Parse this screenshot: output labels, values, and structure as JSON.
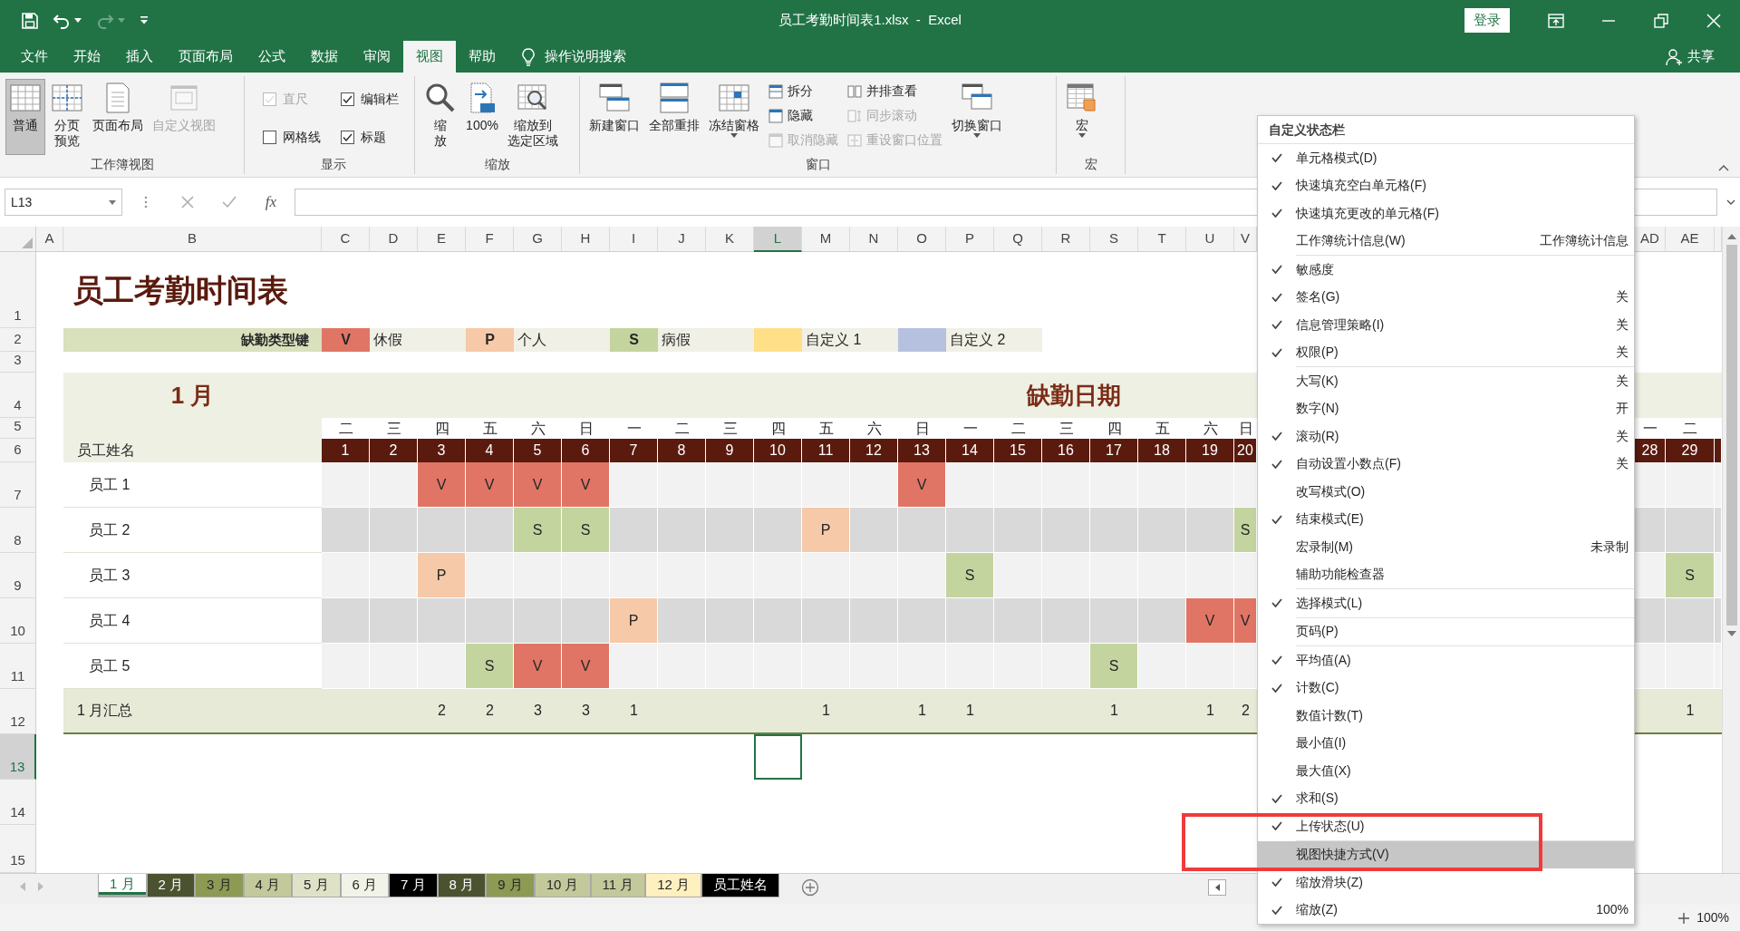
{
  "window": {
    "title": "员工考勤时间表1.xlsx  -  Excel",
    "sign_in": "登录"
  },
  "ribbon_tabs": [
    {
      "label": "文件",
      "selected": false
    },
    {
      "label": "开始",
      "selected": false
    },
    {
      "label": "插入",
      "selected": false
    },
    {
      "label": "页面布局",
      "selected": false
    },
    {
      "label": "公式",
      "selected": false
    },
    {
      "label": "数据",
      "selected": false
    },
    {
      "label": "审阅",
      "selected": false
    },
    {
      "label": "视图",
      "selected": true
    },
    {
      "label": "帮助",
      "selected": false
    }
  ],
  "tell_me": "操作说明搜索",
  "share": "共享",
  "ribbon_groups": [
    {
      "title": "工作簿视图",
      "columns": [
        [
          {
            "kind": "large",
            "lines": [
              "普通"
            ],
            "selected": true,
            "disabled": false
          }
        ],
        [
          {
            "kind": "large",
            "lines": [
              "分页",
              "预览"
            ],
            "selected": false,
            "disabled": false
          }
        ],
        [
          {
            "kind": "large",
            "lines": [
              "页面布局"
            ],
            "selected": false,
            "disabled": false
          }
        ],
        [
          {
            "kind": "large",
            "lines": [
              "自定义视图"
            ],
            "selected": false,
            "disabled": true
          }
        ]
      ]
    },
    {
      "title": "显示",
      "columns": [
        [
          {
            "kind": "check",
            "label": "直尺",
            "checked": true,
            "disabled": true
          },
          {
            "kind": "check",
            "label": "网格线",
            "checked": false,
            "disabled": false
          }
        ],
        [
          {
            "kind": "check",
            "label": "编辑栏",
            "checked": true,
            "disabled": false
          },
          {
            "kind": "check",
            "label": "标题",
            "checked": true,
            "disabled": false
          }
        ]
      ]
    },
    {
      "title": "缩放",
      "columns": [
        [
          {
            "kind": "large",
            "lines": [
              "缩",
              "放"
            ],
            "disabled": false
          }
        ],
        [
          {
            "kind": "large",
            "lines": [
              "100%"
            ],
            "disabled": false
          }
        ],
        [
          {
            "kind": "large",
            "lines": [
              "缩放到",
              "选定区域"
            ],
            "disabled": false
          }
        ]
      ]
    },
    {
      "title": "窗口",
      "columns": [
        [
          {
            "kind": "large",
            "lines": [
              "新建窗口"
            ],
            "disabled": false
          }
        ],
        [
          {
            "kind": "large",
            "lines": [
              "全部重排"
            ],
            "disabled": false
          }
        ],
        [
          {
            "kind": "large",
            "lines": [
              "冻结窗格"
            ],
            "disabled": false,
            "dropdown": true
          }
        ],
        [
          {
            "kind": "small",
            "label": "拆分",
            "disabled": false
          },
          {
            "kind": "small",
            "label": "隐藏",
            "disabled": false
          },
          {
            "kind": "small",
            "label": "取消隐藏",
            "disabled": true
          }
        ],
        [
          {
            "kind": "small",
            "label": "并排查看",
            "disabled": false
          },
          {
            "kind": "small",
            "label": "同步滚动",
            "disabled": true
          },
          {
            "kind": "small",
            "label": "重设窗口位置",
            "disabled": true
          }
        ],
        [
          {
            "kind": "large",
            "lines": [
              "切换窗口"
            ],
            "disabled": false,
            "dropdown": true
          }
        ]
      ]
    },
    {
      "title": "宏",
      "columns": [
        [
          {
            "kind": "large",
            "lines": [
              "宏"
            ],
            "disabled": false,
            "dropdown": true
          }
        ]
      ]
    }
  ],
  "formula_bar": {
    "name_box": "L13",
    "function_button": "fx"
  },
  "sheet": {
    "column_headers": [
      {
        "label": "A",
        "selected": false
      },
      {
        "label": "B",
        "selected": false
      },
      {
        "label": "C",
        "selected": false
      },
      {
        "label": "D",
        "selected": false
      },
      {
        "label": "E",
        "selected": false
      },
      {
        "label": "F",
        "selected": false
      },
      {
        "label": "G",
        "selected": false
      },
      {
        "label": "H",
        "selected": false
      },
      {
        "label": "I",
        "selected": false
      },
      {
        "label": "J",
        "selected": false
      },
      {
        "label": "K",
        "selected": false
      },
      {
        "label": "L",
        "selected": true
      },
      {
        "label": "M",
        "selected": false
      },
      {
        "label": "N",
        "selected": false
      },
      {
        "label": "O",
        "selected": false
      },
      {
        "label": "P",
        "selected": false
      },
      {
        "label": "Q",
        "selected": false
      },
      {
        "label": "R",
        "selected": false
      },
      {
        "label": "S",
        "selected": false
      },
      {
        "label": "T",
        "selected": false
      },
      {
        "label": "U",
        "selected": false
      },
      {
        "label": "V",
        "selected": false
      },
      {
        "label": "AD",
        "selected": false
      },
      {
        "label": "AE",
        "selected": false
      }
    ],
    "row_headers": [
      {
        "label": "1",
        "selected": false
      },
      {
        "label": "2",
        "selected": false
      },
      {
        "label": "3",
        "selected": false
      },
      {
        "label": "4",
        "selected": false
      },
      {
        "label": "5",
        "selected": false
      },
      {
        "label": "6",
        "selected": false
      },
      {
        "label": "7",
        "selected": false
      },
      {
        "label": "8",
        "selected": false
      },
      {
        "label": "9",
        "selected": false
      },
      {
        "label": "10",
        "selected": false
      },
      {
        "label": "11",
        "selected": false
      },
      {
        "label": "12",
        "selected": false
      },
      {
        "label": "13",
        "selected": true
      },
      {
        "label": "14",
        "selected": false
      },
      {
        "label": "15",
        "selected": false
      }
    ],
    "title": "员工考勤时间表",
    "legend": {
      "label": "缺勤类型键",
      "items": [
        {
          "code": "V",
          "text": "休假",
          "color": "#e07565"
        },
        {
          "code": "P",
          "text": "个人",
          "color": "#f6c9a8"
        },
        {
          "code": "S",
          "text": "病假",
          "color": "#c4d49f"
        },
        {
          "text": "自定义 1",
          "color": "#ffdf88"
        },
        {
          "text": "自定义 2",
          "color": "#b6c1df"
        }
      ]
    },
    "month": "1 月",
    "section_title": "缺勤日期",
    "weekdays": [
      "二",
      "三",
      "四",
      "五",
      "六",
      "日",
      "一",
      "二",
      "三",
      "四",
      "五",
      "六",
      "日",
      "一",
      "二",
      "三",
      "四",
      "五",
      "六",
      "日",
      "一",
      "二"
    ],
    "days": [
      "1",
      "2",
      "3",
      "4",
      "5",
      "6",
      "7",
      "8",
      "9",
      "10",
      "11",
      "12",
      "13",
      "14",
      "15",
      "16",
      "17",
      "18",
      "19",
      "20",
      "28",
      "29"
    ],
    "name_header": "员工姓名",
    "employees": [
      {
        "name": "员工 1",
        "cells": [
          {
            "kind": "empty"
          },
          {
            "kind": "empty"
          },
          {
            "kind": "absence",
            "code": "V",
            "color": "#e07565"
          },
          {
            "kind": "absence",
            "code": "V",
            "color": "#e07565"
          },
          {
            "kind": "absence",
            "code": "V",
            "color": "#e07565"
          },
          {
            "kind": "absence",
            "code": "V",
            "color": "#e07565"
          },
          {
            "kind": "empty"
          },
          {
            "kind": "empty"
          },
          {
            "kind": "empty"
          },
          {
            "kind": "empty"
          },
          {
            "kind": "empty"
          },
          {
            "kind": "empty"
          },
          {
            "kind": "absence",
            "code": "V",
            "color": "#e07565"
          },
          {
            "kind": "empty"
          },
          {
            "kind": "empty"
          },
          {
            "kind": "empty"
          },
          {
            "kind": "empty"
          },
          {
            "kind": "empty"
          },
          {
            "kind": "empty"
          },
          {
            "kind": "empty"
          },
          {
            "kind": "empty"
          },
          {
            "kind": "empty"
          }
        ]
      },
      {
        "name": "员工 2",
        "cells": [
          {
            "kind": "empty"
          },
          {
            "kind": "empty"
          },
          {
            "kind": "empty"
          },
          {
            "kind": "empty"
          },
          {
            "kind": "absence",
            "code": "S",
            "color": "#c4d49f"
          },
          {
            "kind": "absence",
            "code": "S",
            "color": "#c4d49f"
          },
          {
            "kind": "empty"
          },
          {
            "kind": "empty"
          },
          {
            "kind": "empty"
          },
          {
            "kind": "empty"
          },
          {
            "kind": "absence",
            "code": "P",
            "color": "#f6c9a8"
          },
          {
            "kind": "empty"
          },
          {
            "kind": "empty"
          },
          {
            "kind": "empty"
          },
          {
            "kind": "empty"
          },
          {
            "kind": "empty"
          },
          {
            "kind": "empty"
          },
          {
            "kind": "empty"
          },
          {
            "kind": "empty"
          },
          {
            "kind": "absence",
            "code": "S",
            "color": "#c4d49f"
          },
          {
            "kind": "empty"
          },
          {
            "kind": "empty"
          }
        ]
      },
      {
        "name": "员工 3",
        "cells": [
          {
            "kind": "empty"
          },
          {
            "kind": "empty"
          },
          {
            "kind": "absence",
            "code": "P",
            "color": "#f6c9a8"
          },
          {
            "kind": "empty"
          },
          {
            "kind": "empty"
          },
          {
            "kind": "empty"
          },
          {
            "kind": "empty"
          },
          {
            "kind": "empty"
          },
          {
            "kind": "empty"
          },
          {
            "kind": "empty"
          },
          {
            "kind": "empty"
          },
          {
            "kind": "empty"
          },
          {
            "kind": "empty"
          },
          {
            "kind": "absence",
            "code": "S",
            "color": "#c4d49f"
          },
          {
            "kind": "empty"
          },
          {
            "kind": "empty"
          },
          {
            "kind": "empty"
          },
          {
            "kind": "empty"
          },
          {
            "kind": "empty"
          },
          {
            "kind": "empty"
          },
          {
            "kind": "empty"
          },
          {
            "kind": "absence",
            "code": "S",
            "color": "#c4d49f"
          }
        ]
      },
      {
        "name": "员工 4",
        "cells": [
          {
            "kind": "empty"
          },
          {
            "kind": "empty"
          },
          {
            "kind": "empty"
          },
          {
            "kind": "empty"
          },
          {
            "kind": "empty"
          },
          {
            "kind": "empty"
          },
          {
            "kind": "absence",
            "code": "P",
            "color": "#f6c9a8"
          },
          {
            "kind": "empty"
          },
          {
            "kind": "empty"
          },
          {
            "kind": "empty"
          },
          {
            "kind": "empty"
          },
          {
            "kind": "empty"
          },
          {
            "kind": "empty"
          },
          {
            "kind": "empty"
          },
          {
            "kind": "empty"
          },
          {
            "kind": "empty"
          },
          {
            "kind": "empty"
          },
          {
            "kind": "empty"
          },
          {
            "kind": "absence",
            "code": "V",
            "color": "#e07565"
          },
          {
            "kind": "absence",
            "code": "V",
            "color": "#e07565"
          },
          {
            "kind": "empty"
          },
          {
            "kind": "empty"
          }
        ]
      },
      {
        "name": "员工 5",
        "cells": [
          {
            "kind": "empty"
          },
          {
            "kind": "empty"
          },
          {
            "kind": "empty"
          },
          {
            "kind": "absence",
            "code": "S",
            "color": "#c4d49f"
          },
          {
            "kind": "absence",
            "code": "V",
            "color": "#e07565"
          },
          {
            "kind": "absence",
            "code": "V",
            "color": "#e07565"
          },
          {
            "kind": "empty"
          },
          {
            "kind": "empty"
          },
          {
            "kind": "empty"
          },
          {
            "kind": "empty"
          },
          {
            "kind": "empty"
          },
          {
            "kind": "empty"
          },
          {
            "kind": "empty"
          },
          {
            "kind": "empty"
          },
          {
            "kind": "empty"
          },
          {
            "kind": "empty"
          },
          {
            "kind": "absence",
            "code": "S",
            "color": "#c4d49f"
          },
          {
            "kind": "empty"
          },
          {
            "kind": "empty"
          },
          {
            "kind": "empty"
          },
          {
            "kind": "empty"
          },
          {
            "kind": "empty"
          }
        ]
      }
    ],
    "total_label": "1 月汇总",
    "totals": [
      {
        "kind": "empty"
      },
      {
        "kind": "empty"
      },
      {
        "kind": "count",
        "value": "2"
      },
      {
        "kind": "count",
        "value": "2"
      },
      {
        "kind": "count",
        "value": "3"
      },
      {
        "kind": "count",
        "value": "3"
      },
      {
        "kind": "count",
        "value": "1"
      },
      {
        "kind": "empty"
      },
      {
        "kind": "empty"
      },
      {
        "kind": "empty"
      },
      {
        "kind": "count",
        "value": "1"
      },
      {
        "kind": "empty"
      },
      {
        "kind": "count",
        "value": "1"
      },
      {
        "kind": "count",
        "value": "1"
      },
      {
        "kind": "empty"
      },
      {
        "kind": "empty"
      },
      {
        "kind": "count",
        "value": "1"
      },
      {
        "kind": "empty"
      },
      {
        "kind": "count",
        "value": "1"
      },
      {
        "kind": "count",
        "value": "2"
      },
      {
        "kind": "empty"
      },
      {
        "kind": "count",
        "value": "1"
      }
    ]
  },
  "sheet_tabs": [
    {
      "label": "1 月",
      "selected": true,
      "color": "#217346"
    },
    {
      "label": "2 月",
      "selected": false,
      "color": "#4b5230"
    },
    {
      "label": "3 月",
      "selected": false,
      "color": "#8c9a54"
    },
    {
      "label": "4 月",
      "selected": false,
      "color": "#c3c99a"
    },
    {
      "label": "5 月",
      "selected": false,
      "color": "#dfe2c6"
    },
    {
      "label": "6 月",
      "selected": false,
      "color": "#f2f3e8"
    },
    {
      "label": "7 月",
      "selected": false,
      "color": "#000000"
    },
    {
      "label": "8 月",
      "selected": false,
      "color": "#4b5230"
    },
    {
      "label": "9 月",
      "selected": false,
      "color": "#8c9a54"
    },
    {
      "label": "10 月",
      "selected": false,
      "color": "#c3c99a"
    },
    {
      "label": "11 月",
      "selected": false,
      "color": "#c3c99a"
    },
    {
      "label": "12 月",
      "selected": false,
      "color": "#fff0c0"
    },
    {
      "label": "员工姓名",
      "selected": false,
      "color": "#000000"
    }
  ],
  "status_bar": {
    "zoom": "100%"
  },
  "context_menu": {
    "title": "自定义状态栏",
    "items": [
      {
        "label": "单元格模式(D)",
        "checked": true,
        "selected": false
      },
      {
        "label": "快速填充空白单元格(F)",
        "checked": true,
        "selected": false
      },
      {
        "label": "快速填充更改的单元格(F)",
        "checked": true,
        "selected": false
      },
      {
        "label": "工作簿统计信息(W)",
        "checked": false,
        "selected": false,
        "value": "工作簿统计信息",
        "separator_after": true
      },
      {
        "label": "敏感度",
        "checked": true,
        "selected": false
      },
      {
        "label": "签名(G)",
        "checked": true,
        "selected": false,
        "value": "关"
      },
      {
        "label": "信息管理策略(I)",
        "checked": true,
        "selected": false,
        "value": "关"
      },
      {
        "label": "权限(P)",
        "checked": true,
        "selected": false,
        "value": "关",
        "separator_after": true
      },
      {
        "label": "大写(K)",
        "checked": false,
        "selected": false,
        "value": "关"
      },
      {
        "label": "数字(N)",
        "checked": false,
        "selected": false,
        "value": "开"
      },
      {
        "label": "滚动(R)",
        "checked": true,
        "selected": false,
        "value": "关"
      },
      {
        "label": "自动设置小数点(F)",
        "checked": true,
        "selected": false,
        "value": "关"
      },
      {
        "label": "改写模式(O)",
        "checked": false,
        "selected": false
      },
      {
        "label": "结束模式(E)",
        "checked": true,
        "selected": false
      },
      {
        "label": "宏录制(M)",
        "checked": false,
        "selected": false,
        "value": "未录制"
      },
      {
        "label": "辅助功能检查器",
        "checked": false,
        "selected": false,
        "separator_after": true
      },
      {
        "label": "选择模式(L)",
        "checked": true,
        "selected": false,
        "separator_after": true
      },
      {
        "label": "页码(P)",
        "checked": false,
        "selected": false,
        "separator_after": true
      },
      {
        "label": "平均值(A)",
        "checked": true,
        "selected": false
      },
      {
        "label": "计数(C)",
        "checked": true,
        "selected": false
      },
      {
        "label": "数值计数(T)",
        "checked": false,
        "selected": false
      },
      {
        "label": "最小值(I)",
        "checked": false,
        "selected": false
      },
      {
        "label": "最大值(X)",
        "checked": false,
        "selected": false
      },
      {
        "label": "求和(S)",
        "checked": true,
        "selected": false
      },
      {
        "label": "上传状态(U)",
        "checked": true,
        "selected": false,
        "separator_after": true
      },
      {
        "label": "视图快捷方式(V)",
        "checked": false,
        "selected": true
      },
      {
        "label": "缩放滑块(Z)",
        "checked": true,
        "selected": false
      },
      {
        "label": "缩放(Z)",
        "checked": true,
        "selected": false,
        "value": "100%"
      }
    ]
  },
  "annotation": {
    "kind": "rectangle"
  }
}
